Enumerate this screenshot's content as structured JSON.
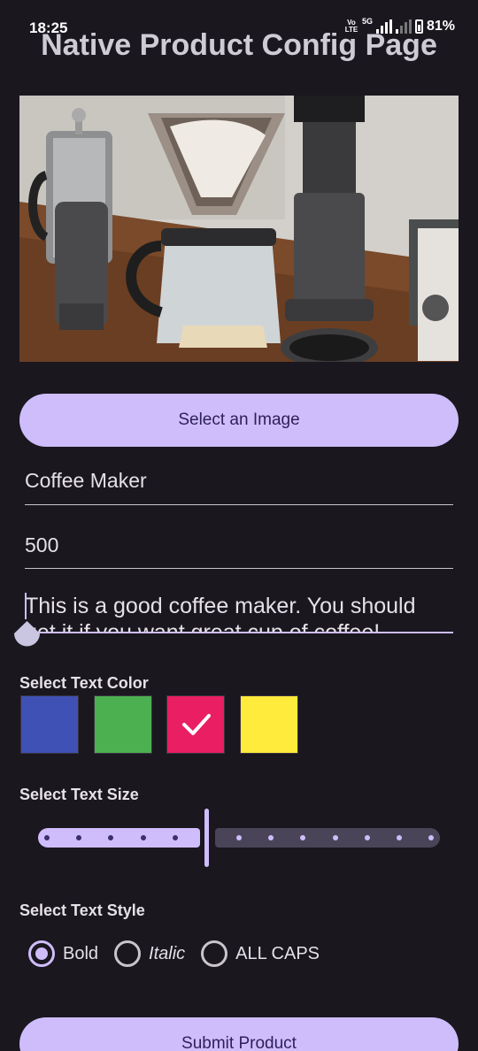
{
  "status_bar": {
    "time": "18:25",
    "volte": "Vo LTE",
    "network": "5G",
    "battery": "81%"
  },
  "page_title": "Native Product Config Page",
  "image_section": {
    "select_button_label": "Select an Image"
  },
  "form": {
    "name_value": "Coffee Maker",
    "price_value": "500",
    "description_line1": "This is a good coffee maker. You should",
    "description_line2": "get it if you want great cup of coffee!"
  },
  "text_color": {
    "label": "Select Text Color",
    "swatches": [
      {
        "name": "blue",
        "color": "#3f51b5",
        "selected": false
      },
      {
        "name": "green",
        "color": "#4caf50",
        "selected": false
      },
      {
        "name": "pink",
        "color": "#e91e63",
        "selected": true
      },
      {
        "name": "yellow",
        "color": "#ffeb3b",
        "selected": false
      }
    ]
  },
  "text_size": {
    "label": "Select Text Size",
    "steps": 13,
    "value_fraction": 0.42
  },
  "text_style": {
    "label": "Select Text Style",
    "options": [
      {
        "label": "Bold",
        "selected": true
      },
      {
        "label": "Italic",
        "selected": false
      },
      {
        "label": "ALL CAPS",
        "selected": false
      }
    ]
  },
  "submit_label": "Submit Product",
  "colors": {
    "background": "#1a171f",
    "accent": "#cfbdfb",
    "on_accent": "#2c1f5a"
  }
}
